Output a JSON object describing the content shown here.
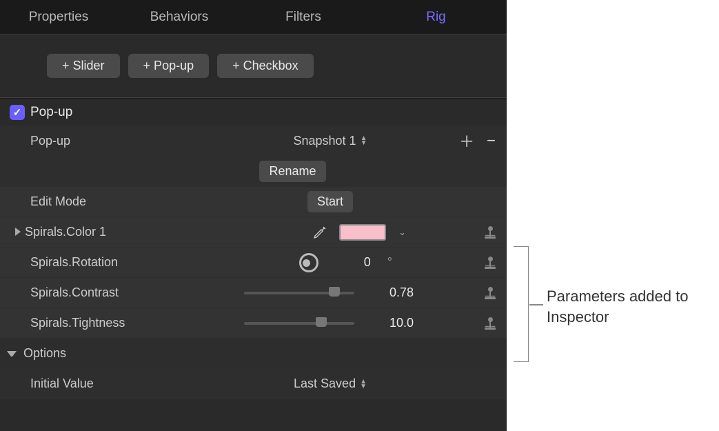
{
  "tabs": {
    "items": [
      {
        "label": "Properties"
      },
      {
        "label": "Behaviors"
      },
      {
        "label": "Filters"
      },
      {
        "label": "Rig"
      }
    ],
    "active_index": 3
  },
  "toolbar": {
    "add_slider": "+ Slider",
    "add_popup": "+ Pop-up",
    "add_checkbox": "+ Checkbox"
  },
  "rig": {
    "popup_section_label": "Pop-up",
    "popup_checked": true,
    "popup_param_label": "Pop-up",
    "popup_value": "Snapshot 1",
    "rename_button": "Rename",
    "edit_mode_label": "Edit Mode",
    "start_button": "Start",
    "params": [
      {
        "label": "Spirals.Color 1",
        "color": "#f9bfca"
      },
      {
        "label": "Spirals.Rotation",
        "value": "0",
        "unit": "°"
      },
      {
        "label": "Spirals.Contrast",
        "value": "0.78",
        "slider_pct": 82
      },
      {
        "label": "Spirals.Tightness",
        "value": "10.0",
        "slider_pct": 70
      }
    ],
    "options_label": "Options",
    "initial_value_label": "Initial Value",
    "initial_value": "Last Saved"
  },
  "annotation": {
    "callout": "Parameters added to Inspector"
  }
}
